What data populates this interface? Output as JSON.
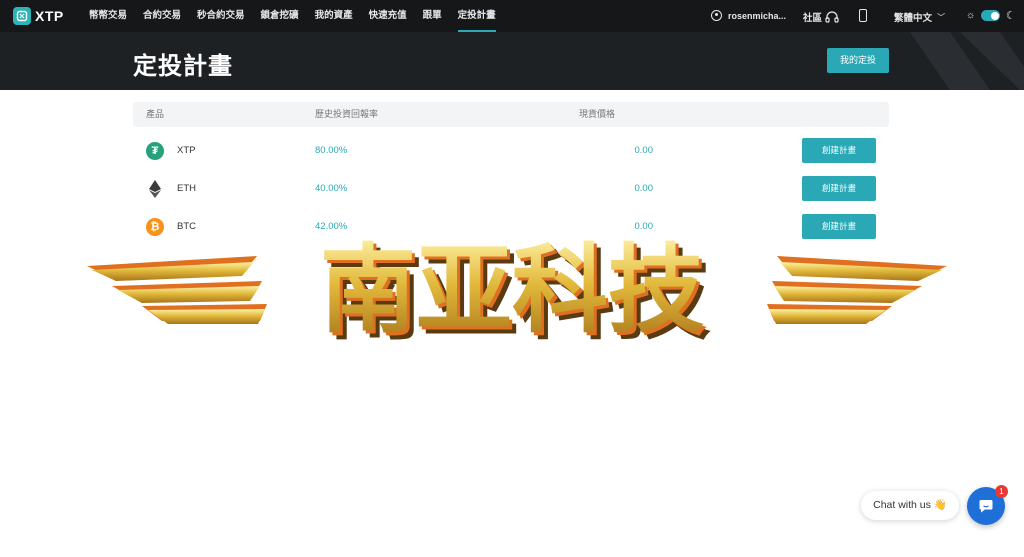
{
  "brand": {
    "name": "XTP",
    "accent": "#2ba8b5"
  },
  "nav": {
    "items": [
      {
        "label": "幣幣交易"
      },
      {
        "label": "合約交易"
      },
      {
        "label": "秒合約交易"
      },
      {
        "label": "鎖倉挖礦"
      },
      {
        "label": "我的資產"
      },
      {
        "label": "快速充值"
      },
      {
        "label": "跟單"
      },
      {
        "label": "定投計畫",
        "active": true
      }
    ]
  },
  "header": {
    "username": "rosenmicha...",
    "community": "社區",
    "language": "繁體中文"
  },
  "banner": {
    "title": "定投計畫",
    "my_plan_label": "我的定投"
  },
  "table": {
    "headers": {
      "product": "產品",
      "rate": "歷史投資回報率",
      "price": "現貨價格"
    },
    "rows": [
      {
        "coin": "XTP",
        "icon": "tether-icon",
        "icon_color": "#26a17b",
        "rate": "80.00%",
        "price": "0.00",
        "action": "創建計畫"
      },
      {
        "coin": "ETH",
        "icon": "ethereum-icon",
        "icon_color": "#3c3c3d",
        "rate": "40.00%",
        "price": "0.00",
        "action": "創建計畫"
      },
      {
        "coin": "BTC",
        "icon": "bitcoin-icon",
        "icon_color": "#f7931a",
        "rate": "42.00%",
        "price": "0.00",
        "action": "創建計畫"
      }
    ]
  },
  "watermark": {
    "text": "南亚科技"
  },
  "chat": {
    "bubble_text": "Chat with us 👋",
    "badge_count": "1"
  }
}
